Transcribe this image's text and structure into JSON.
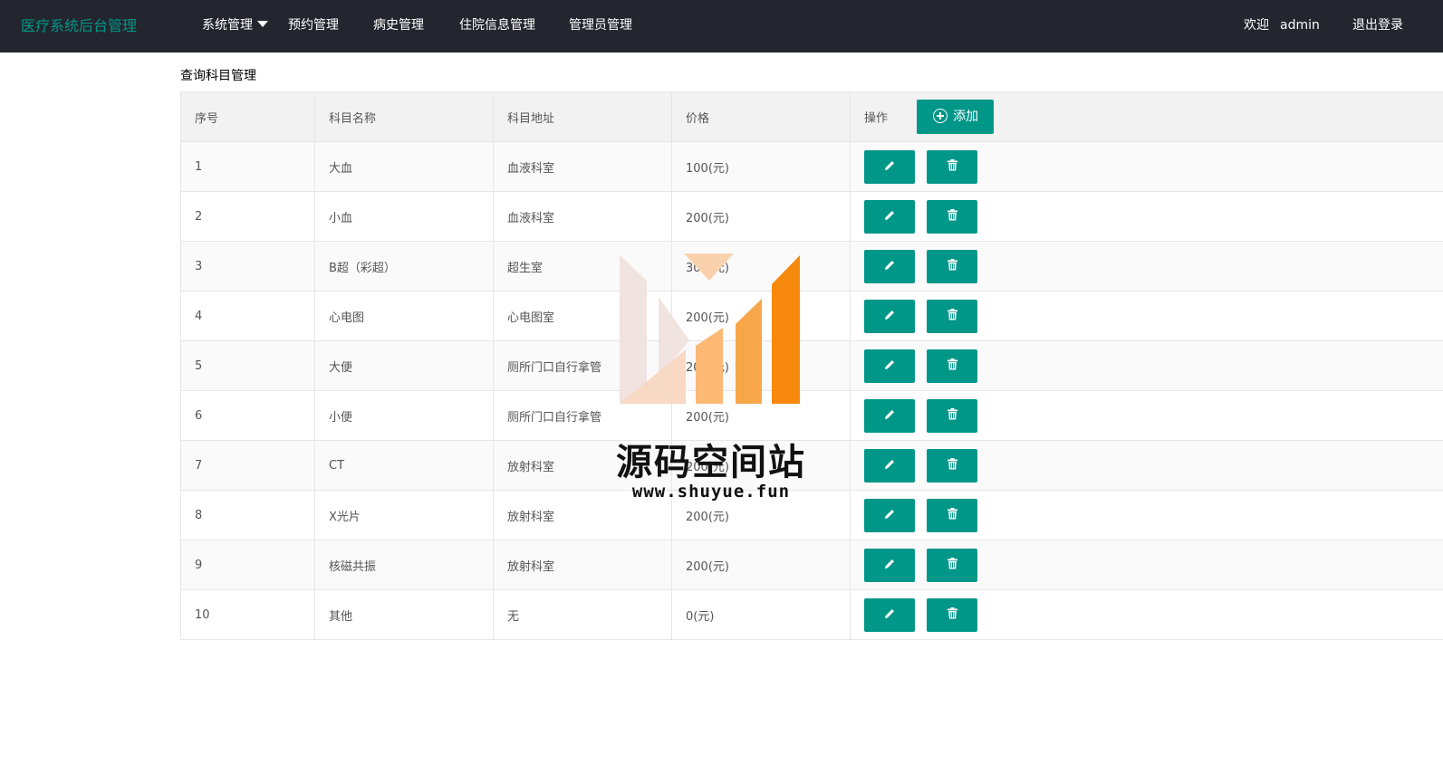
{
  "header": {
    "brand": "医疗系统后台管理",
    "nav": [
      {
        "label": "系统管理"
      },
      {
        "label": "预约管理"
      },
      {
        "label": "病史管理"
      },
      {
        "label": "住院信息管理"
      },
      {
        "label": "管理员管理"
      }
    ],
    "welcome": "欢迎",
    "username": "admin",
    "logout": "退出登录"
  },
  "main": {
    "title": "查询科目管理",
    "columns": [
      "序号",
      "科目名称",
      "科目地址",
      "价格",
      "操作"
    ],
    "add_label": "添加",
    "rows": [
      {
        "id": "1",
        "name": "大血",
        "address": "血液科室",
        "price": "100(元)"
      },
      {
        "id": "2",
        "name": "小血",
        "address": "血液科室",
        "price": "200(元)"
      },
      {
        "id": "3",
        "name": "B超（彩超）",
        "address": "超生室",
        "price": "300(元)"
      },
      {
        "id": "4",
        "name": "心电图",
        "address": "心电图室",
        "price": "200(元)"
      },
      {
        "id": "5",
        "name": "大便",
        "address": "厕所门口自行拿管",
        "price": "200(元)"
      },
      {
        "id": "6",
        "name": "小便",
        "address": "厕所门口自行拿管",
        "price": "200(元)"
      },
      {
        "id": "7",
        "name": "CT",
        "address": "放射科室",
        "price": "200(元)"
      },
      {
        "id": "8",
        "name": "X光片",
        "address": "放射科室",
        "price": "200(元)"
      },
      {
        "id": "9",
        "name": "核磁共振",
        "address": "放射科室",
        "price": "200(元)"
      },
      {
        "id": "10",
        "name": "其他",
        "address": "无",
        "price": "0(元)"
      }
    ]
  },
  "watermark": {
    "text": "源码空间站",
    "url": "www.shuyue.fun"
  },
  "icons": {
    "add": "circle-plus-icon",
    "edit": "pencil-icon",
    "delete": "trash-icon",
    "dropdown": "caret-down-icon"
  },
  "colors": {
    "header_bg": "#23262e",
    "brand": "#009688",
    "primary_button": "#009688",
    "table_header_bg": "#f2f2f2",
    "border": "#e6e6e6"
  }
}
